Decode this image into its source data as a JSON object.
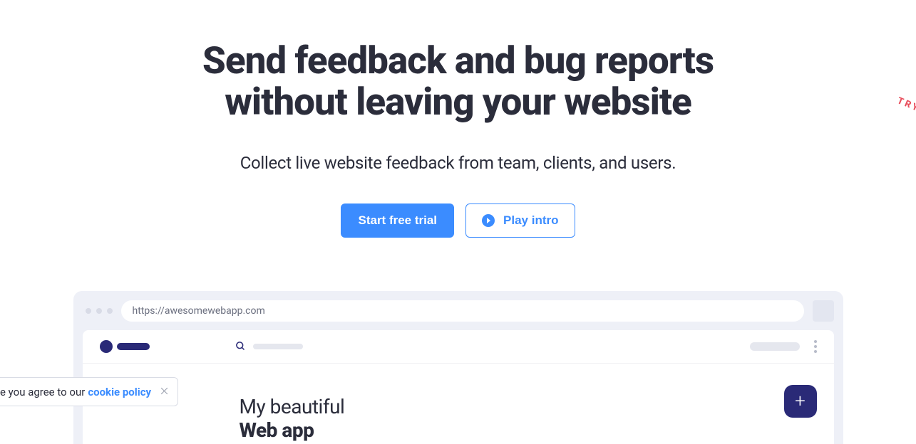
{
  "hero": {
    "title_line1": "Send feedback and bug reports",
    "title_line2": "without leaving your website",
    "subtitle": "Collect live website feedback from team, clients, and users."
  },
  "cta": {
    "primary": "Start free trial",
    "secondary": "Play intro"
  },
  "browser": {
    "url": "https://awesomewebapp.com"
  },
  "app": {
    "heading_line1": "My beautiful",
    "heading_line2": "Web app",
    "fab_label": "+"
  },
  "cookie": {
    "text": "e you agree to our ",
    "link_text": "cookie policy"
  },
  "badge": {
    "try": "TRY"
  },
  "colors": {
    "primary_blue": "#3b8cff",
    "dark_text": "#2b2d3b",
    "dark_indigo": "#2a2a77",
    "try_red": "#e84f5d"
  }
}
